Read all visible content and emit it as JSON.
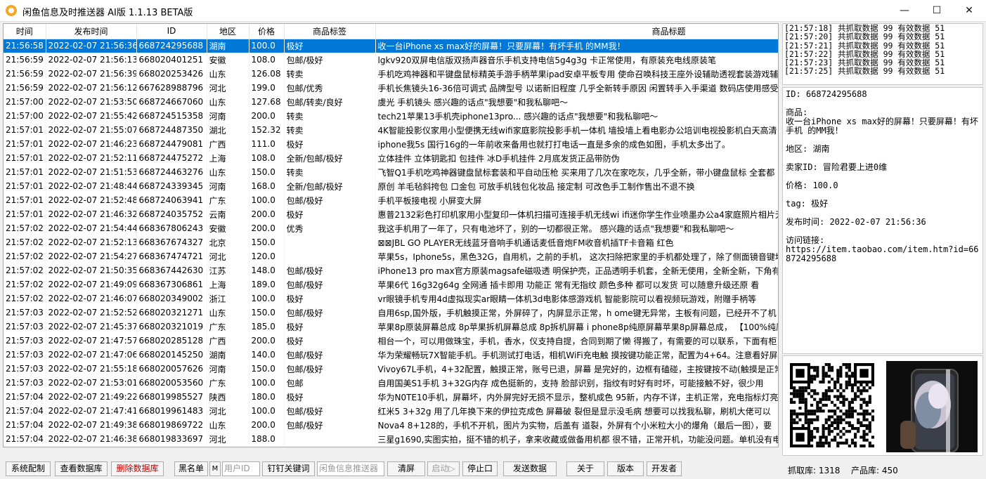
{
  "window": {
    "title": "闲鱼信息及时推送器 AI版 1.1.13 BETA版",
    "minimize": "—",
    "maximize": "☐",
    "close": "✕"
  },
  "table": {
    "columns": [
      "时间",
      "发布时间",
      "ID",
      "地区",
      "价格",
      "商品标签",
      "商品标题"
    ],
    "rows": [
      [
        "21:56:58",
        "2022-02-07 21:56:36",
        "668724295688",
        "湖南",
        "100.0",
        "极好",
        "收一台iPhone xs max好的屏幕！只要屏幕！有坏手机 的MM我！"
      ],
      [
        "21:56:59",
        "2022-02-07 21:56:13",
        "668020401251",
        "安徽",
        "108.0",
        "包邮/极好",
        "lgkv920双屏电信版双扬声器音乐手机支持电信5g4g3g 卡正常使用，有原装充电线原装笔"
      ],
      [
        "21:56:59",
        "2022-02-07 21:56:39",
        "668020253426",
        "山东",
        "126.08",
        "转卖",
        "手机吃鸡神器和平键盘鼠标精英手游手柄苹果ipad安卓平板专用 使命召唤科技王座外设辅助透视套装游戏辅"
      ],
      [
        "21:56:59",
        "2022-02-07 21:56:12",
        "667628988796",
        "河北",
        "199.0",
        "包邮/优秀",
        "手机长焦镜头16-36倍可调式 品牌型号 以诺新旧程度 几乎全新转手原因 闲置转手入手渠道 数码店使用感受"
      ],
      [
        "21:57:00",
        "2022-02-07 21:53:50",
        "668724667060",
        "山东",
        "127.68",
        "包邮/转卖/良好",
        "虞光 手机镜头 感兴趣的话点\"我想要\"和我私聊吧～"
      ],
      [
        "21:57:00",
        "2022-02-07 21:55:42",
        "668724515358",
        "河南",
        "200.0",
        "转卖",
        "tech21苹果13手机壳iphone13pro... 感兴趣的话点\"我想要\"和我私聊吧～"
      ],
      [
        "21:57:01",
        "2022-02-07 21:55:07",
        "668724487350",
        "湖北",
        "152.32",
        "转卖",
        "4K智能投影仪家用小型便携无线wifi家庭影院投影手机一体机 墙投墙上看电影办公培训电视投影机白天高清"
      ],
      [
        "21:57:01",
        "2022-02-07 21:46:23",
        "668724479081",
        "广西",
        "111.0",
        "极好",
        "iphone我5s 国行16g的一年前收来备用也就打打电话一直是多余的成色如图，手机太多出了。"
      ],
      [
        "21:57:01",
        "2022-02-07 21:52:11",
        "668724475272",
        "上海",
        "108.0",
        "全新/包邮/极好",
        "立体挂件 立体钥匙扣 包挂件 冰D手机挂件 2月底发货正品带防伪"
      ],
      [
        "21:57:01",
        "2022-02-07 21:51:53",
        "668724463276",
        "山东",
        "150.0",
        "转卖",
        "飞智Q1手机吃鸡神器键盘鼠标套装和平自动压枪 买来用了几次在家吃灰，几乎全新，带小键盘鼠标 全套都"
      ],
      [
        "21:57:01",
        "2022-02-07 21:48:44",
        "668724339345",
        "河南",
        "168.0",
        "全新/包邮/极好",
        "原创 羊毛毡斜挎包 口金包 可放手机钱包化妆品 接定制 可改色手工制作售出不退不换"
      ],
      [
        "21:57:01",
        "2022-02-07 21:52:48",
        "668724063941",
        "广东",
        "100.0",
        "包邮/极好",
        "手机平板接电视 小屏变大屏"
      ],
      [
        "21:57:01",
        "2022-02-07 21:46:32",
        "668724035752",
        "云南",
        "200.0",
        "极好",
        "惠普2132彩色打印机家用小型复印一体机扫描可连接手机无线wi ifi迷你学生作业喷墨办公a4家庭照片相片无"
      ],
      [
        "21:57:02",
        "2022-02-07 21:54:44",
        "668367806243",
        "安徽",
        "200.0",
        "优秀",
        "我这手机用了一年了，只有电池坏了，别的一切都很正常。 感兴趣的话点\"我想要\"和我私聊吧～"
      ],
      [
        "21:57:02",
        "2022-02-07 21:52:13",
        "668367674327",
        "北京",
        "150.0",
        "",
        "⊠⊠JBL GO PLAYER无线蓝牙音响手机通话麦低音炮FM收音机插TF卡音箱 红色"
      ],
      [
        "21:57:02",
        "2022-02-07 21:54:27",
        "668367474721",
        "河北",
        "120.0",
        "",
        "苹果5s，Iphone5s，黑色32G，自用机，之前的手机， 这次扫除把家里的手机都处理了，除了侧面镜音键坏"
      ],
      [
        "21:57:02",
        "2022-02-07 21:50:35",
        "668367442630",
        "江苏",
        "148.0",
        "包邮/极好",
        "iPhone13 pro max官方原装magsafe磁吸透 明保护壳，正品透明手机套，全新无使用，全新全新，下角有"
      ],
      [
        "21:57:02",
        "2022-02-07 21:49:09",
        "668367306861",
        "上海",
        "189.0",
        "包邮/极好",
        "苹果6代 16g32g64g 全网通 插卡即用 功能正 常有无指纹 颜色多种 都可以发货 可以随意升级还原 看"
      ],
      [
        "21:57:02",
        "2022-02-07 21:46:07",
        "668020349002",
        "浙江",
        "100.0",
        "极好",
        "vr眼镜手机专用4d虚拟现实ar眼睛一体机3d电影体感游戏机 智能影院可以看视频玩游戏，附赠手柄等"
      ],
      [
        "21:57:03",
        "2022-02-07 21:52:52",
        "668020321271",
        "山东",
        "150.0",
        "包邮/极好",
        "自用6sp,国外版，手机触摸正常，外屏碎了，内屏显示正常，h ome键无异常，主板有问题，已经开不了机"
      ],
      [
        "21:57:03",
        "2022-02-07 21:45:37",
        "668020321019",
        "广东",
        "185.0",
        "极好",
        "苹果8p原装屏幕总成 8p苹果拆机屏幕总成 8p拆机屏幕 i phone8p纯原屏幕苹果8p屏幕总成， 【100%纯原"
      ],
      [
        "21:57:03",
        "2022-02-07 21:47:57",
        "668020285128",
        "广西",
        "200.0",
        "极好",
        "相台一个，可以用做珠宝，手机，香水，仪支持自提，合同到期了懒 得搬了，有需要的可以联系，下面有柜"
      ],
      [
        "21:57:03",
        "2022-02-07 21:47:06",
        "668020145250",
        "湖南",
        "140.0",
        "包邮/极好",
        "华为荣耀畅玩7X智能手机。手机测试打电话，相机WiFi充电触 摸按键功能正常，配置为4+64。注意看好屏"
      ],
      [
        "21:57:03",
        "2022-02-07 21:55:18",
        "668020057626",
        "河南",
        "150.0",
        "包邮/极好",
        "Vivoy67L手机，4+32配置，触摸正常，账号已退，屏幕 是完好的，边框有磕碰，主按键按不动(触摸是正常"
      ],
      [
        "21:57:03",
        "2022-02-07 21:53:01",
        "668020053560",
        "广东",
        "100.0",
        "包邮",
        "自用国美S1手机 3+32G内存 成色挺新的，支持 脸部识别，指纹有时好有时坏，可能接触不好，很少用"
      ],
      [
        "21:57:04",
        "2022-02-07 21:49:22",
        "668019985527",
        "陕西",
        "180.0",
        "极好",
        "华为N0TE10手机，屏幕坏，内外屏完好无损不显示，整机成色 95新，内存不详，主机正常，充电指标灯亮"
      ],
      [
        "21:57:04",
        "2022-02-07 21:47:41",
        "668019961483",
        "河北",
        "100.0",
        "包邮/极好",
        "红米5 3+32g 用了几年换下来的伊拉克成色 屏幕破 裂但是显示没毛病 想要可以找我私聊，刷机大佬可以"
      ],
      [
        "21:57:04",
        "2022-02-07 21:49:38",
        "668019869722",
        "山东",
        "200.0",
        "包邮/极好",
        "Nova4 8+128的，手机不开机，图片为实物，后盖有 道裂，外屏有个小米粒大小的爆角（最后一图），要"
      ],
      [
        "21:57:04",
        "2022-02-07 21:46:38",
        "668019833697",
        "河北",
        "188.0",
        "",
        "三星g1690,实图实拍，挺不错的机子，拿来收藏或做备用机都 很不错，正常开机，功能没问题。单机没有电"
      ]
    ]
  },
  "log": [
    "[21:57:18] 共抓取数据 99 有效数据 51",
    "[21:57:20] 共抓取数据 99 有效数据 51",
    "[21:57:21] 共抓取数据 99 有效数据 51",
    "[21:57:22] 共抓取数据 99 有效数据 51",
    "[21:57:23] 共抓取数据 99 有效数据 51",
    "[21:57:25] 共抓取数据 99 有效数据 51"
  ],
  "detail": {
    "id": "ID: 668724295688",
    "goods": "商品:\n收一台iPhone xs max好的屏幕！只要屏幕！有坏手机 的MM我！",
    "region": "地区: 湖南",
    "seller": "卖家ID: 冒险君要上进0维",
    "price": "价格: 100.0",
    "tag": "tag: 极好",
    "publish": "发布时间: 2022-02-07 21:56:36",
    "link": "访问链接:\nhttps://item.taobao.com/item.htm?id=668724295688"
  },
  "toolbar": {
    "sys_config": "系统配制",
    "view_db": "查看数据库",
    "delete_db": "删除数据库",
    "blacklist": "黑名单",
    "m_label": "M",
    "user_id_placeholder": "用户ID",
    "dingtalk": "钉钉关键词",
    "pusher_placeholder": "闲鱼信息推送器",
    "clear": "清屏",
    "start": "启动▷",
    "stop": "停止口",
    "send": "发送数据",
    "about": "关于",
    "version": "版本",
    "developer": "开发者"
  },
  "status": {
    "crawl": "抓取库: 1318",
    "product": "产品库: 450"
  },
  "colors": {
    "selection": "#0078d7",
    "delete_text": "#c00000",
    "disabled_text": "#a0a0a0"
  }
}
